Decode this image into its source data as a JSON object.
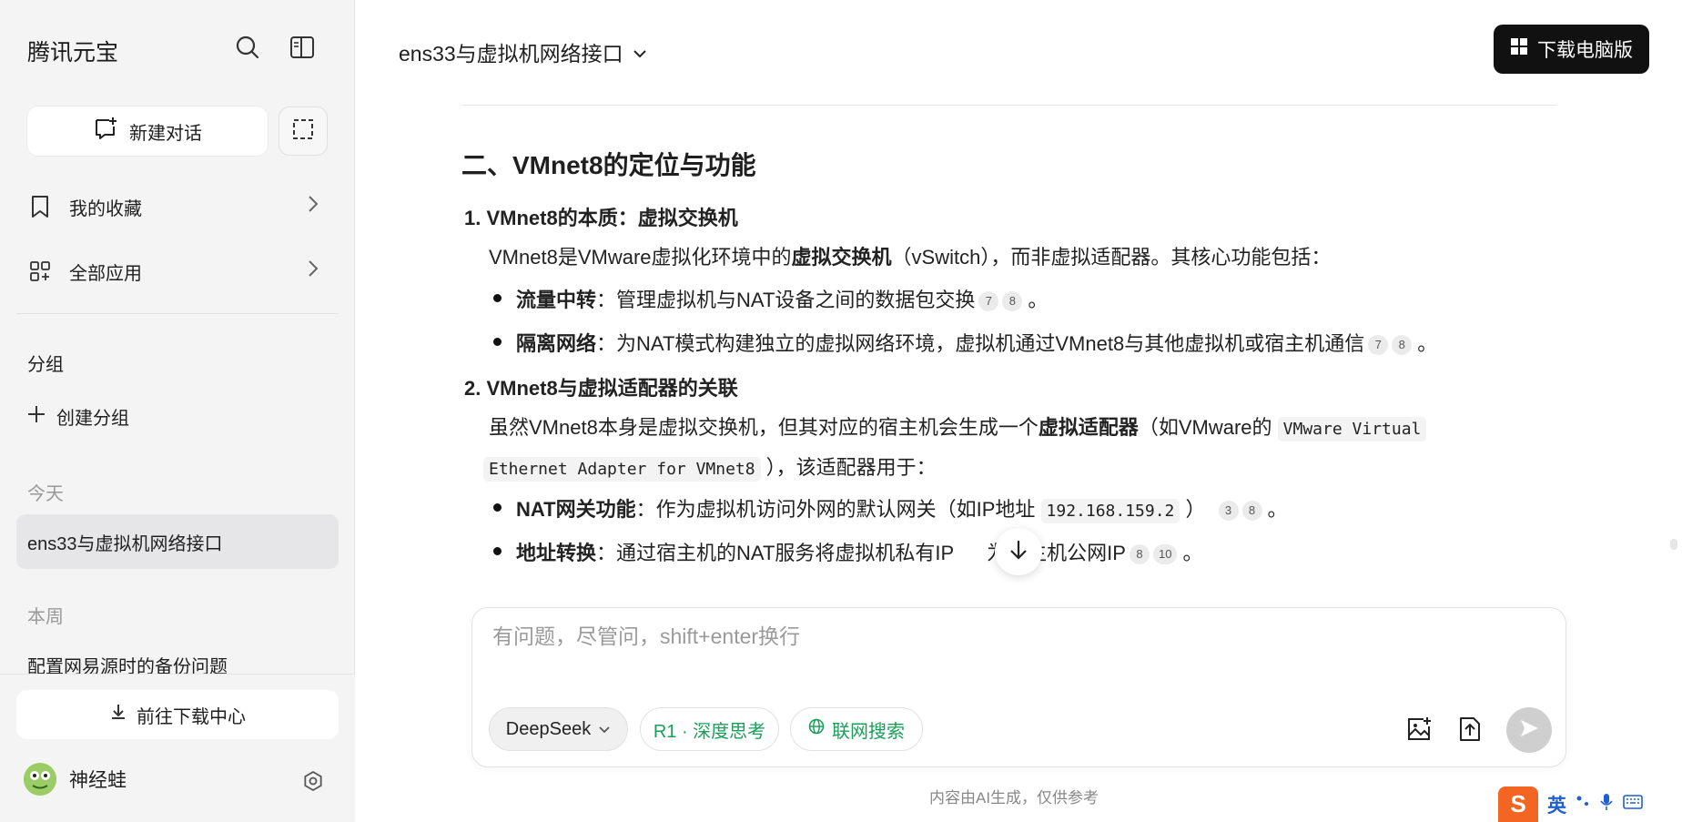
{
  "app": {
    "brand": "腾讯元宝"
  },
  "sidebar": {
    "new_chat": "新建对话",
    "favorites": "我的收藏",
    "all_apps": "全部应用",
    "group_label": "分组",
    "create_group": "创建分组",
    "today_label": "今天",
    "active_conversation": "ens33与虚拟机网络接口",
    "week_label": "本周",
    "week_item": "配置网易源时的备份问题",
    "download_center": "前往下载中心",
    "user_name": "神经蛙"
  },
  "header": {
    "title": "ens33与虚拟机网络接口",
    "download_pc": "下载电脑版"
  },
  "article": {
    "section_title": "二、VMnet8的定位与功能",
    "item1": {
      "num": "1.",
      "title": "VMnet8的本质：虚拟交换机",
      "desc_a": "VMnet8是VMware虚拟化环境中的",
      "desc_b": "虚拟交换机",
      "desc_c": "（vSwitch），而非虚拟适配器。其核心功能包括：",
      "b1_title": "流量中转",
      "b1_text": "：管理虚拟机与NAT设备之间的数据包交换",
      "b1_c1": "7",
      "b1_c2": "8",
      "b1_end": "。",
      "b2_title": "隔离网络",
      "b2_text": "：为NAT模式构建独立的虚拟网络环境，虚拟机通过VMnet8与其他虚拟机或宿主机通信",
      "b2_c1": "7",
      "b2_c2": "8",
      "b2_end": "。"
    },
    "item2": {
      "num": "2.",
      "title": "VMnet8与虚拟适配器的关联",
      "desc_a": "虽然VMnet8本身是虚拟交换机，但其对应的宿主机会生成一个",
      "desc_b": "虚拟适配器",
      "desc_c": "（如VMware的",
      "code1": "VMware Virtual",
      "code2": "Ethernet Adapter for VMnet8",
      "desc_d": "），该适配器用于：",
      "b1_title": "NAT网关功能",
      "b1_text": "：作为虚拟机访问外网的默认网关（如IP地址",
      "b1_code": "192.168.159.2",
      "b1_close": "）",
      "b1_c1": "3",
      "b1_c2": "8",
      "b1_end": "。",
      "b2_title": "地址转换",
      "b2_text_a": "：通过宿主机的NAT服务将虚拟机私有IP",
      "b2_text_b": "为宿主机公网IP",
      "b2_c1": "8",
      "b2_c2": "10",
      "b2_end": "。"
    }
  },
  "composer": {
    "placeholder": "有问题，尽管问，shift+enter换行",
    "model": "DeepSeek",
    "think": "R1 · 深度思考",
    "web": "联网搜索",
    "disclaimer": "内容由AI生成，仅供参考"
  },
  "ime": {
    "logo": "S",
    "lang": "英"
  },
  "colors": {
    "accent_green": "#1a9f5a",
    "sidebar_bg": "#f4f4f5",
    "dark_button": "#111111"
  }
}
